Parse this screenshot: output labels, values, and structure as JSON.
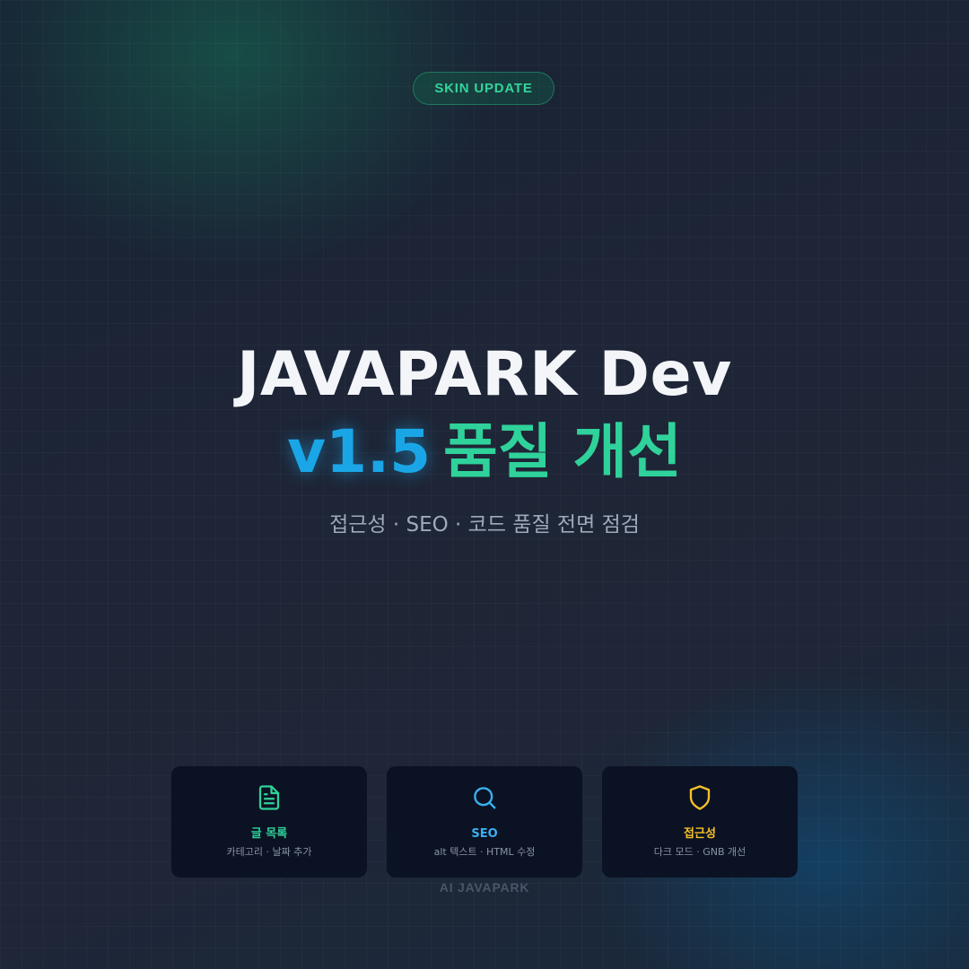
{
  "badge": {
    "label": "SKIN UPDATE"
  },
  "hero": {
    "title": "JAVAPARK Dev",
    "version": "v1.5",
    "headline": "품질 개선",
    "tagline": "접근성 · SEO · 코드 품질 전면 점검"
  },
  "cards": [
    {
      "icon": "document-icon",
      "title": "글 목록",
      "description": "카테고리 · 날짜 추가",
      "color": "#2fd29a"
    },
    {
      "icon": "search-icon",
      "title": "SEO",
      "description": "alt 텍스트 · HTML 수정",
      "color": "#3ab0f0"
    },
    {
      "icon": "shield-icon",
      "title": "접근성",
      "description": "다크 모드 · GNB 개선",
      "color": "#f5c02a"
    }
  ],
  "footer": {
    "brand": "AI JAVAPARK"
  },
  "colors": {
    "accent_green": "#2fd29a",
    "accent_blue": "#1aa6e6",
    "accent_yellow": "#f5c02a",
    "background": "#1e2536",
    "card_background": "#0b1223"
  }
}
